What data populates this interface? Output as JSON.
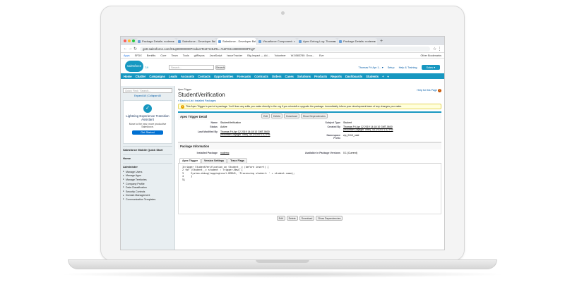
{
  "browser": {
    "tabs": [
      {
        "label": "Package Details: nodemc",
        "active": false
      },
      {
        "label": "Salesforce - Developer Ed",
        "active": false
      },
      {
        "label": "Salesforce - Developer Ed",
        "active": true
      },
      {
        "label": "Visualforce Component: ",
        "active": false
      },
      {
        "label": "Apex Debug Log: Thomas",
        "active": false
      },
      {
        "label": "Package Details: nodemc",
        "active": false
      }
    ],
    "new_tab": "+",
    "url": "gs0.salesforce.com/01q80000000ProductTest?retURL=%2F03A38000000PKgF",
    "bookmarks": [
      "Apps",
      "SFDX",
      "Benifits",
      "Core",
      "Team",
      "Tools",
      "gitRepos",
      "JavaScript",
      "IssueTracker",
      "Big Impact — Ad...",
      "Volunteer",
      "W-5583780: Grou...",
      "Eve"
    ],
    "other_bookmarks": "Other Bookmarks"
  },
  "salesforce": {
    "logo": "salesforce",
    "logo_badge": "'19",
    "search_placeholder": "Search...",
    "search_button": "Search",
    "user_menu": "Thomas Fri Apr 1... ▾",
    "setup": "Setup",
    "help_training": "Help & Training",
    "app_menu": "Sales ▾",
    "nav": [
      "Home",
      "Chatter",
      "Campaigns",
      "Leads",
      "Accounts",
      "Contacts",
      "Opportunities",
      "Forecasts",
      "Contracts",
      "Orders",
      "Cases",
      "Solutions",
      "Products",
      "Reports",
      "Dashboards",
      "Students",
      "+",
      "▾"
    ]
  },
  "sidebar": {
    "quick_find": "Quick Find / Search...",
    "expand": "Expand All | Collapse All",
    "lex_icon": "✓",
    "lex_title": "Lightning Experience Transition Assistant",
    "lex_sub": "Move to the new, more productive Salesforce.",
    "lex_button": "Get Started",
    "mobile": "Salesforce Mobile Quick Start",
    "home": "Home",
    "administer": "Administer",
    "items": [
      "Manage Users",
      "Manage Apps",
      "Manage Territories",
      "Company Profile",
      "Data Classification",
      "Security Controls",
      "Domain Management",
      "Communication Templates"
    ]
  },
  "page": {
    "kicker": "Apex Trigger",
    "title": "StudentVerification",
    "help": "Help for this Page",
    "back": "« Back to List: Installed Packages",
    "warning": "This Apex Trigger is part of a package. You'll lose any edits you make directly in the org if you reinstall or upgrade the package. Immediately inform your development team of any changes you make.",
    "detail_title": "Apex Trigger Detail",
    "buttons": [
      "Edit",
      "Delete",
      "Download",
      "Show Dependencies"
    ],
    "fields": {
      "name_label": "Name",
      "name": "StudentVerification",
      "status_label": "Status",
      "status": "Active",
      "modified_label": "Last Modified By",
      "modified": "Thomas Fri Apr 12 2019 14:18:10 GMT-0600 (Mountain Daylight Time), 4/12/2019 1:32 PM",
      "sobject_label": "Subject Type",
      "sobject": "Student",
      "created_label": "Created By",
      "created": "Thomas Fri Apr 12 2019 14:18:10 GMT-0600 (Mountain Daylight Time), 4/12/2019 1:32 PM",
      "ns_label": "Namespace Prefix",
      "ns": "zip_0110_nsid"
    },
    "pkg_title": "Package Information",
    "pkg_installed_label": "Installed Package",
    "pkg_installed": "nodemc",
    "pkg_version_label": "Available in Package Versions",
    "pkg_version": "0.1 (Current)",
    "subtabs": [
      "Apex Trigger",
      "Version Settings",
      "Trace Flags"
    ],
    "code": "1trigger StudentVerification on Student__c (before insert) {\n2 for (Student__c student : Trigger.New) {\n3     System.debug(LoggingLevel.DEBUG, 'Processing student: ' + student.name);\n4     }\n5}"
  }
}
